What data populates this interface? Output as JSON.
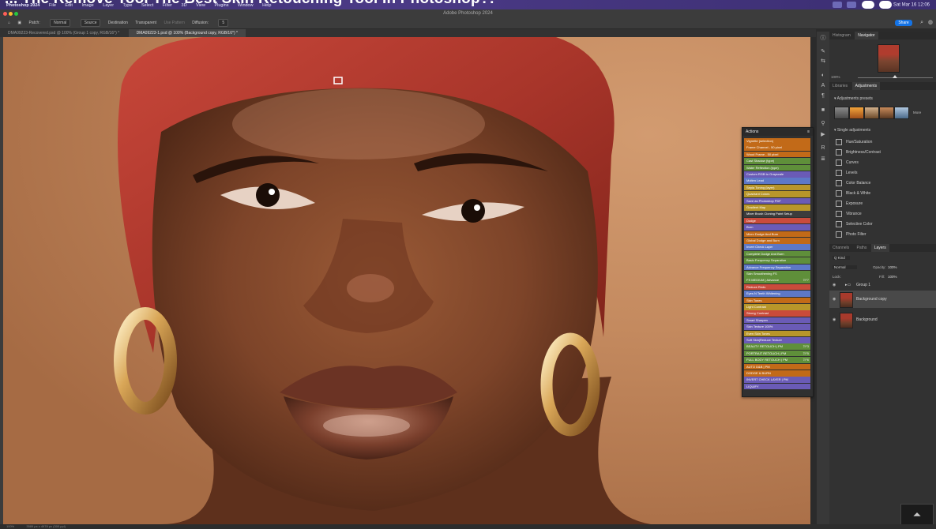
{
  "video_title": "... The Remove Tool The Best Skin Retouching Tool In Photoshop?!",
  "mac_menu": {
    "app_name": "Photoshop 2024",
    "items": [
      "File",
      "Edit",
      "Image",
      "Layer",
      "Type",
      "Select",
      "Filter",
      "3D",
      "View",
      "Plugins",
      "Window",
      "Help"
    ],
    "clock": "Sat Mar 16  12:06"
  },
  "window_title": "Adobe Photoshop 2024",
  "options_bar": {
    "patch_label": "Patch:",
    "patch_value": "Normal",
    "source": "Source",
    "destination": "Destination",
    "transparent": "Transparent",
    "use_pattern": "Use Pattern",
    "diffusion_label": "Diffusion:",
    "diffusion_value": "5",
    "share": "Share"
  },
  "doc_tabs": [
    "DMA09223-Recovered.psd @ 100% (Group 1 copy, RGB/16*) *",
    "DMA09223-1.psd @ 100% (Background copy, RGB/16*) *"
  ],
  "navigator": {
    "tabs": [
      "Histogram",
      "Navigator"
    ],
    "zoom": "100%"
  },
  "adjustments": {
    "tabs": [
      "Libraries",
      "Adjustments"
    ],
    "presets_title": "Adjustments presets",
    "more_label": "More",
    "single_title": "Single adjustments",
    "items": [
      "Hue/Saturation",
      "Brightness/Contrast",
      "Curves",
      "Levels",
      "Color Balance",
      "Black & White",
      "Exposure",
      "Vibrance",
      "Selective Color",
      "Photo Filter"
    ]
  },
  "layers": {
    "tabs": [
      "Channels",
      "Paths",
      "Layers"
    ],
    "kind_label": "Q Kind",
    "blend_mode": "Normal",
    "opacity_label": "Opacity:",
    "opacity_value": "100%",
    "lock_label": "Lock:",
    "fill_label": "Fill:",
    "fill_value": "100%",
    "group_name": "Group 1",
    "rows": [
      "Background copy",
      "Background"
    ]
  },
  "actions": {
    "title": "Actions",
    "items": [
      {
        "label": "Vignette (selection)",
        "color": "#c26a18",
        "key": ""
      },
      {
        "label": "Frame Channel - 50 pixel",
        "color": "#c26a18",
        "key": ""
      },
      {
        "label": "Wood Frame - 50 pixel",
        "color": "#c26a18",
        "key": ""
      },
      {
        "label": "Cast Shadow (type)",
        "color": "#5f8f3a",
        "key": ""
      },
      {
        "label": "Water Reflection (type)",
        "color": "#5f8f3a",
        "key": ""
      },
      {
        "label": "Custom RGB to Grayscale",
        "color": "#6a5bb6",
        "key": ""
      },
      {
        "label": "Molten Lead",
        "color": "#5d78c7",
        "key": ""
      },
      {
        "label": "Sepia Toning (layer)",
        "color": "#b8962a",
        "key": ""
      },
      {
        "label": "Quadrant Colors",
        "color": "#b8962a",
        "key": ""
      },
      {
        "label": "Save as Photoshop PDF",
        "color": "#6a5bb6",
        "key": ""
      },
      {
        "label": "Gradient Map",
        "color": "#b8962a",
        "key": ""
      },
      {
        "label": "Mixer Brush Cloning Paint Setup",
        "color": "#3c3c3c",
        "key": ""
      },
      {
        "label": "Dodge",
        "color": "#c94b3b",
        "key": ""
      },
      {
        "label": "Burn",
        "color": "#6a5bb6",
        "key": ""
      },
      {
        "label": "Micro Dodge And Burn",
        "color": "#c26a18",
        "key": ""
      },
      {
        "label": "Global Dodge and Burn",
        "color": "#c26a18",
        "key": ""
      },
      {
        "label": "Invert Check Layer",
        "color": "#5d78c7",
        "key": ""
      },
      {
        "label": "Complete Dodge And Burn",
        "color": "#5f8f3a",
        "key": ""
      },
      {
        "label": "Basic Frequency Separation",
        "color": "#5f8f3a",
        "key": ""
      },
      {
        "label": "Advance Frequency Separation",
        "color": "#5d78c7",
        "key": ""
      },
      {
        "label": "Skin Smoothening FS",
        "color": "#5f8f3a",
        "key": ""
      },
      {
        "label": "FS MEDIUM | Advance",
        "color": "#5f8f3a",
        "key": "⇧F7"
      },
      {
        "label": "Reduce Reds",
        "color": "#c94b3b",
        "key": ""
      },
      {
        "label": "Eyes N Teeth Whitening",
        "color": "#5d78c7",
        "key": ""
      },
      {
        "label": "Skin Tones",
        "color": "#c26a18",
        "key": ""
      },
      {
        "label": "Light Contrast",
        "color": "#b8962a",
        "key": ""
      },
      {
        "label": "Strong Contrast",
        "color": "#c94b3b",
        "key": ""
      },
      {
        "label": "Smart Sharpen",
        "color": "#6a5bb6",
        "key": ""
      },
      {
        "label": "Skin Texture 100%",
        "color": "#6a5bb6",
        "key": ""
      },
      {
        "label": "Even Skin Tones",
        "color": "#b8962a",
        "key": ""
      },
      {
        "label": "Soft Skin|Reduce Texture",
        "color": "#6a5bb6",
        "key": ""
      },
      {
        "label": "BEAUTY RETOUCH | PM",
        "color": "#5f8f3a",
        "key": "⇧F3"
      },
      {
        "label": "PORTRAIT RETOUCH | PM",
        "color": "#5f8f3a",
        "key": "⇧F5"
      },
      {
        "label": "FULL BODY RETOUCH | PM",
        "color": "#5f8f3a",
        "key": "⇧F6"
      },
      {
        "label": "AUTO D&B | PM",
        "color": "#c26a18",
        "key": ""
      },
      {
        "label": "DODGE & BURN",
        "color": "#c26a18",
        "key": ""
      },
      {
        "label": "INVERT CHECK LAYER | PM",
        "color": "#6a5bb6",
        "key": ""
      },
      {
        "label": "LIQUIFY",
        "color": "#6a5bb6",
        "key": ""
      }
    ]
  },
  "status_bar": {
    "zoom": "100%",
    "doc_size": "3589 px x 4978 px (300 ppi)"
  }
}
